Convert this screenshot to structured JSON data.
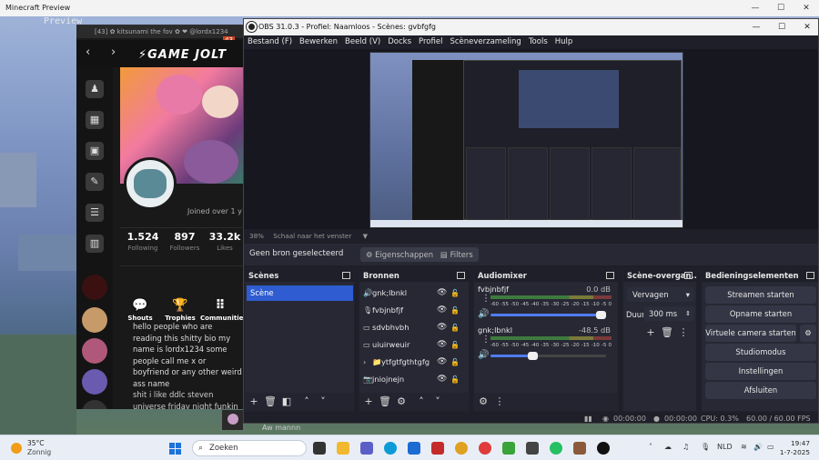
{
  "minecraft": {
    "title": "Minecraft Preview",
    "hud_text": "Preview",
    "controls": [
      "—",
      "☐",
      "✕"
    ]
  },
  "gamejolt": {
    "top_text": "[43] ✿ kitsunami the fov ✿ ❤ @lordx1234",
    "badge": "43",
    "logo": "⚡GAME JOLT",
    "joined": "Joined over 1 y",
    "stats": [
      {
        "value": "1.524",
        "label": "Following"
      },
      {
        "value": "897",
        "label": "Followers"
      },
      {
        "value": "33.2k",
        "label": "Likes"
      }
    ],
    "tabs": [
      {
        "label": "Shouts",
        "icon": "💬"
      },
      {
        "label": "Trophies",
        "icon": "🏆"
      },
      {
        "label": "Communities",
        "icon": "⠿"
      }
    ],
    "bio": "hello people who are reading this shitty bio my name is lordx1234 some people call me x or boyfriend or any other weird ass name",
    "bio2": "shit i like ddlc steven universe friday night funkin"
  },
  "obs": {
    "title": "OBS 31.0.3 - Profiel: Naamloos - Scènes: gvbfgfg",
    "menu": [
      "Bestand (F)",
      "Bewerken",
      "Beeld (V)",
      "Docks",
      "Profiel",
      "Scèneverzameling",
      "Tools",
      "Hulp"
    ],
    "zoom_pct": "38%",
    "zoom_label": "Schaal naar het venster",
    "no_source": "Geen bron geselecteerd",
    "properties_btn": "Eigenschappen",
    "filters_btn": "Filters",
    "docks": {
      "scenes": "Scènes",
      "sources": "Bronnen",
      "mixer": "Audiomixer",
      "transitions": "Scène-overgan...",
      "controls": "Bedieningselementen"
    },
    "scene_items": [
      "Scène"
    ],
    "sources": [
      {
        "name": "gnk;lbnkl",
        "icon": "🔊"
      },
      {
        "name": "fvbjnbfjf",
        "icon": "🎙"
      },
      {
        "name": "sdvbhvbh",
        "icon": "▭"
      },
      {
        "name": "uiuirweuir",
        "icon": "▭"
      },
      {
        "name": "ytfgtfgthtgfg",
        "icon": "📁"
      },
      {
        "name": "jniojnejn",
        "icon": "📷"
      }
    ],
    "mixer": [
      {
        "name": "fvbjnbfjf",
        "db": "0.0 dB",
        "level": 1.0
      },
      {
        "name": "gnk;lbnkl",
        "db": "-48.5 dB",
        "level": 0.35
      }
    ],
    "meter_ticks": [
      "-60",
      "-55",
      "-50",
      "-45",
      "-40",
      "-35",
      "-30",
      "-25",
      "-20",
      "-15",
      "-10",
      "-5",
      "0"
    ],
    "transition": {
      "type": "Vervagen",
      "duration_label": "Duur",
      "duration": "300 ms"
    },
    "controls": [
      "Streamen starten",
      "Opname starten",
      "Virtuele camera starten",
      "Studiomodus",
      "Instellingen",
      "Afsluiten"
    ],
    "status": {
      "stream_time": "00:00:00",
      "rec_time": "00:00:00",
      "cpu": "CPU: 0.3%",
      "fps": "60.00 / 60.00 FPS"
    }
  },
  "taskbar": {
    "temp": "35°C",
    "weather": "Zonnig",
    "search_placeholder": "Zoeken",
    "lang": "NLD",
    "time": "19:47",
    "date": "1-7-2025"
  },
  "notif_text": "Aw mannn"
}
